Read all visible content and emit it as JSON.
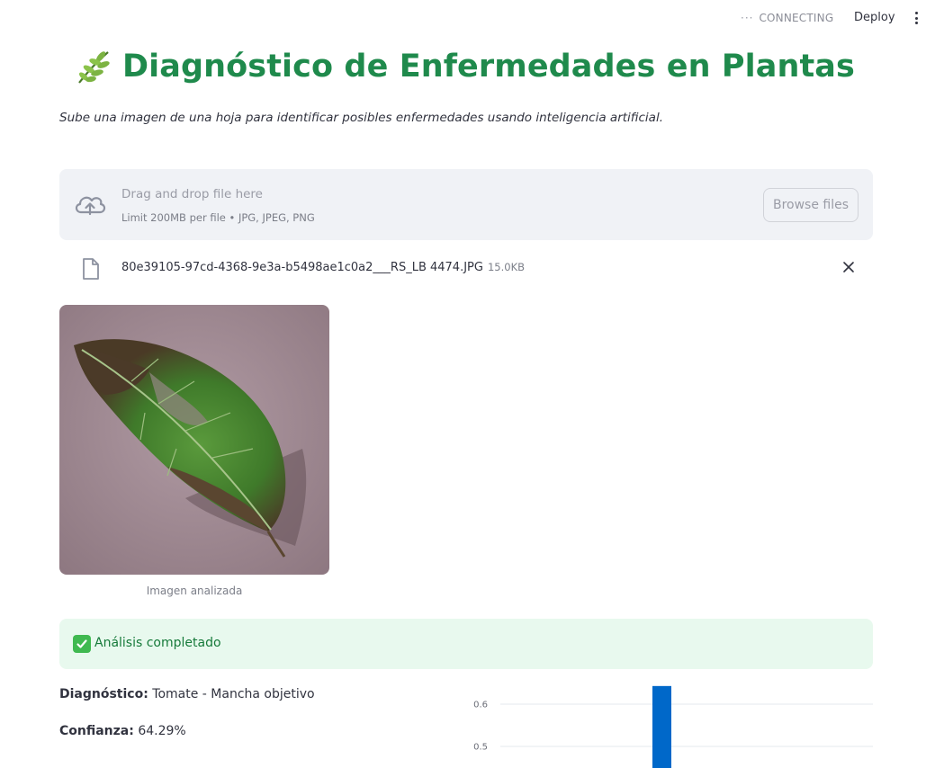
{
  "header": {
    "status_text": "CONNECTING",
    "deploy_label": "Deploy"
  },
  "page": {
    "title": "Diagnóstico de Enfermedades en Plantas",
    "subtitle": "Sube una imagen de una hoja para identificar posibles enfermedades usando inteligencia artificial."
  },
  "uploader": {
    "drag_text": "Drag and drop file here",
    "limit_text": "Limit 200MB per file • JPG, JPEG, PNG",
    "browse_label": "Browse files"
  },
  "file": {
    "name": "80e39105-97cd-4368-9e3a-b5498ae1c0a2___RS_LB 4474.JPG",
    "size": "15.0KB"
  },
  "image": {
    "caption": "Imagen analizada"
  },
  "result": {
    "success_text": "Análisis completado",
    "diagnosis_label": "Diagnóstico:",
    "diagnosis_value": "Tomate - Mancha objetivo",
    "confidence_label": "Confianza:",
    "confidence_value": "64.29%"
  },
  "colors": {
    "accent_green": "#1f8a4c",
    "bar_blue": "#0068c9",
    "success_bg": "#e8f9ee"
  },
  "chart_data": {
    "type": "bar",
    "title": "",
    "xlabel": "",
    "ylabel": "",
    "y_ticks": [
      "0.6",
      "0.5"
    ],
    "visible_range": [
      0.45,
      0.65
    ],
    "grid": true,
    "values": [
      0.6429
    ]
  }
}
